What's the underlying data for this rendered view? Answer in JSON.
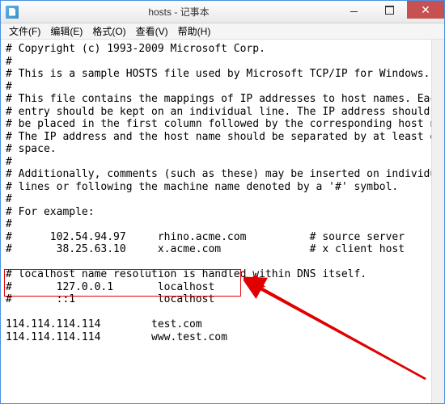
{
  "window": {
    "title": "hosts - 记事本",
    "close_label": "✕"
  },
  "menu": {
    "file": "文件(F)",
    "edit": "编辑(E)",
    "format": "格式(O)",
    "view": "查看(V)",
    "help": "帮助(H)"
  },
  "body_text": "# Copyright (c) 1993-2009 Microsoft Corp.\n#\n# This is a sample HOSTS file used by Microsoft TCP/IP for Windows.\n#\n# This file contains the mappings of IP addresses to host names. Each\n# entry should be kept on an individual line. The IP address should\n# be placed in the first column followed by the corresponding host name.\n# The IP address and the host name should be separated by at least one\n# space.\n#\n# Additionally, comments (such as these) may be inserted on individual\n# lines or following the machine name denoted by a '#' symbol.\n#\n# For example:\n#\n#      102.54.94.97     rhino.acme.com          # source server\n#       38.25.63.10     x.acme.com              # x client host\n\n# localhost name resolution is handled within DNS itself.\n#       127.0.0.1       localhost\n#       ::1             localhost\n\n114.114.114.114        test.com\n114.114.114.114        www.test.com"
}
